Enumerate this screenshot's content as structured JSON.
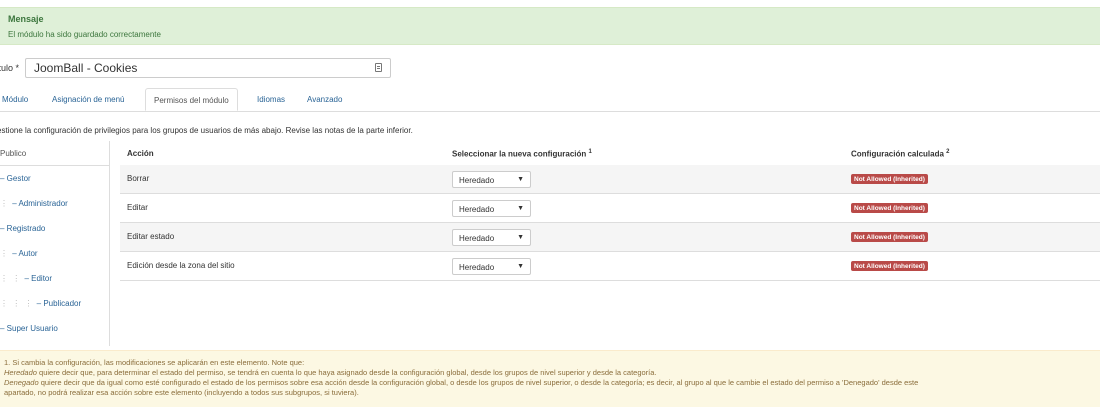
{
  "message": {
    "heading": "Mensaje",
    "text": "El módulo ha sido guardado correctamente"
  },
  "title_field": {
    "label": "ítulo *",
    "value": "JoomBall - Cookies",
    "icon": "list-icon"
  },
  "tabs": [
    {
      "label": "Módulo"
    },
    {
      "label": "Asignación de menú"
    },
    {
      "label": "Permisos del módulo",
      "active": true
    },
    {
      "label": "Idiomas"
    },
    {
      "label": "Avanzado"
    }
  ],
  "description": "estione la configuración de privilegios para los grupos de usuarios de más abajo. Revise las notas de la parte inferior.",
  "groups": [
    {
      "prefix": "",
      "label": "Publico"
    },
    {
      "prefix": "",
      "label": "– Gestor"
    },
    {
      "prefix": "⋮ ",
      "label": "– Administrador"
    },
    {
      "prefix": "",
      "label": "– Registrado"
    },
    {
      "prefix": "⋮ ",
      "label": "– Autor"
    },
    {
      "prefix": "⋮ ⋮ ",
      "label": "– Editor"
    },
    {
      "prefix": "⋮ ⋮ ⋮ ",
      "label": "– Publicador"
    },
    {
      "prefix": "",
      "label": "– Super Usuario"
    }
  ],
  "table": {
    "headers": {
      "action": "Acción",
      "select": "Seleccionar la nueva configuración",
      "select_sup": "1",
      "computed": "Configuración calculada",
      "computed_sup": "2"
    },
    "rows": [
      {
        "action": "Borrar",
        "setting": "Heredado",
        "computed": "Not Allowed (Inherited)"
      },
      {
        "action": "Editar",
        "setting": "Heredado",
        "computed": "Not Allowed (Inherited)"
      },
      {
        "action": "Editar estado",
        "setting": "Heredado",
        "computed": "Not Allowed (Inherited)"
      },
      {
        "action": "Edición desde la zona del sitio",
        "setting": "Heredado",
        "computed": "Not Allowed (Inherited)"
      }
    ],
    "caret": "▼"
  },
  "notes": {
    "line1": "1. Si cambia la configuración, las modificaciones se aplicarán en este elemento. Note que:",
    "line2_em": "Heredado",
    "line2": " quiere decir que, para determinar el estado del permiso, se tendrá en cuenta lo que haya asignado desde la configuración global, desde los grupos de nivel superior y desde la categoría.",
    "line3_em": "Denegado",
    "line3": " quiere decir que da igual como esté configurado el estado de los permisos sobre esa acción desde la configuración global, o desde los grupos de nivel superior, o desde la categoría; es decir, al grupo al que le cambie el estado del permiso a 'Denegado' desde este",
    "line4": "apartado, no podrá realizar esa acción sobre este elemento (incluyendo a todos sus subgrupos, si tuviera)."
  },
  "colors": {
    "success_bg": "#dff0d8",
    "link": "#2a6496",
    "badge": "#b94a48",
    "notes_bg": "#fcf8e3"
  }
}
